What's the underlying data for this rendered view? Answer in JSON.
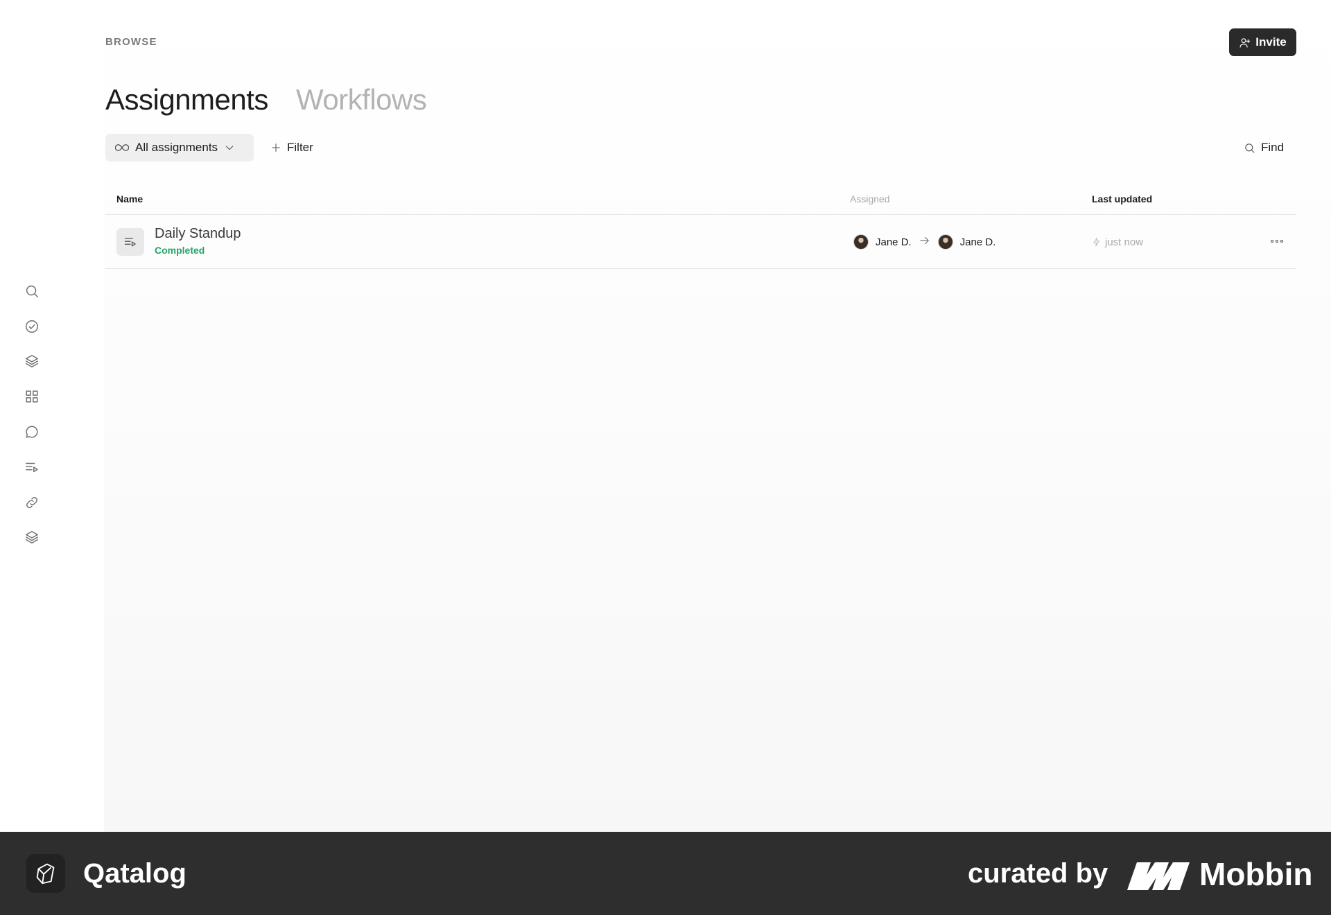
{
  "header": {
    "breadcrumb": "BROWSE",
    "invite_label": "Invite"
  },
  "tabs": [
    {
      "label": "Assignments",
      "active": true
    },
    {
      "label": "Workflows",
      "active": false
    }
  ],
  "toolbar": {
    "view_label": "All assignments",
    "filter_label": "Filter",
    "find_label": "Find"
  },
  "table": {
    "columns": {
      "name": "Name",
      "assigned": "Assigned",
      "updated": "Last updated"
    },
    "rows": [
      {
        "title": "Daily Standup",
        "status": "Completed",
        "from": "Jane D.",
        "to": "Jane D.",
        "updated": "just now"
      }
    ]
  },
  "sidebar": {
    "icons": [
      "search-icon",
      "check-circle-icon",
      "layers-icon",
      "grid-icon",
      "chat-icon",
      "playlist-icon",
      "link-icon",
      "layers-icon"
    ]
  },
  "footer": {
    "app_name": "Qatalog",
    "curated_by": "curated by",
    "mobbin": "Mobbin"
  },
  "colors": {
    "status_completed": "#22a565",
    "primary_button": "#2a2a2a",
    "footer_bg": "#2e2e2e"
  }
}
